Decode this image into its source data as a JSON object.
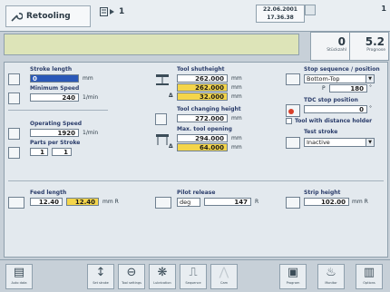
{
  "header": {
    "title": "Retooling",
    "step": "1",
    "date": "22.06.2001",
    "time": "17.36.38",
    "right_value": "1"
  },
  "counters": [
    {
      "value": "0",
      "label": "Stückzahl"
    },
    {
      "value": "5.2",
      "label": "Prognose"
    }
  ],
  "stroke_length": {
    "label": "Stroke length",
    "value": "0",
    "unit": "mm"
  },
  "minimum_speed": {
    "label": "Minimum Speed",
    "value": "240",
    "unit": "1/min"
  },
  "operating_speed": {
    "label": "Operating Speed",
    "value": "1920",
    "unit": "1/min"
  },
  "parts_per_stroke": {
    "label": "Parts per Stroke",
    "value_a": "1",
    "value_b": "1"
  },
  "tool_shutheight": {
    "label": "Tool shutheight",
    "value": "262.000",
    "value_yellow": "262.000",
    "delta": "32.000",
    "unit": "mm",
    "delta_symbol": "Δ"
  },
  "tool_changing_height": {
    "label": "Tool changing height",
    "value": "272.000",
    "unit": "mm"
  },
  "max_tool_opening": {
    "label": "Max. tool opening",
    "value": "294.000",
    "delta": "64.000",
    "unit": "mm",
    "delta_symbol": "Δ"
  },
  "stop_sequence": {
    "label": "Stop sequence / position",
    "selected": "Bottom-Top",
    "p_label": "P",
    "p_value": "180",
    "p_unit": "°"
  },
  "tdc_stop": {
    "label": "TDC stop position",
    "value": "0",
    "unit": "°"
  },
  "tool_distance_holder": {
    "label": "Tool with distance holder"
  },
  "test_stroke": {
    "label": "Test stroke",
    "selected": "Inactive"
  },
  "feed_length": {
    "label": "Feed length",
    "value": "12.40",
    "value_yellow": "12.40",
    "unit": "mm R"
  },
  "pilot_release": {
    "label": "Pilot release",
    "mode": "deg",
    "value": "147",
    "unit": "R"
  },
  "strip_height": {
    "label": "Strip height",
    "value": "102.00",
    "unit": "mm R"
  },
  "toolbar": [
    {
      "glyph": "▤",
      "caption": "Auto data"
    },
    {
      "glyph": "↕",
      "caption": "Set stroke"
    },
    {
      "glyph": "⊖",
      "caption": "Tool settings"
    },
    {
      "glyph": "❋",
      "caption": "Lubrication"
    },
    {
      "glyph": "⎍",
      "caption": "Sequence"
    },
    {
      "glyph": "⋀",
      "caption": "Cam"
    },
    {
      "glyph": "▣",
      "caption": "Program"
    },
    {
      "glyph": "♨",
      "caption": "Monitor"
    },
    {
      "glyph": "▥",
      "caption": "Options"
    }
  ]
}
